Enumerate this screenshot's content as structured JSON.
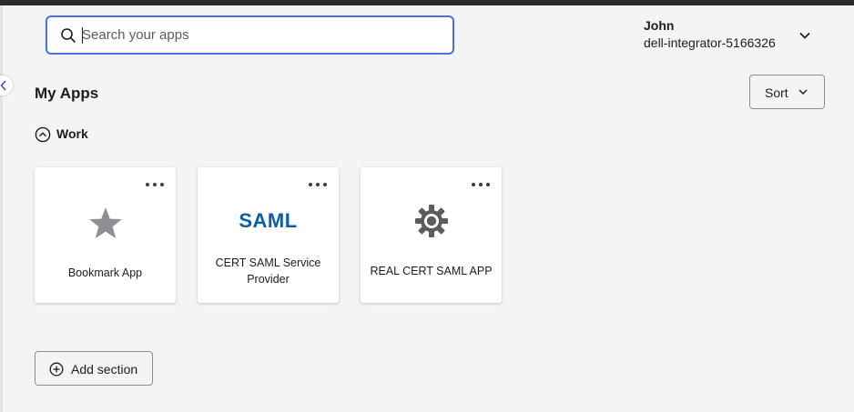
{
  "search": {
    "placeholder": "Search your apps",
    "value": ""
  },
  "user": {
    "name": "John",
    "org": "dell-integrator-5166326"
  },
  "page": {
    "title": "My Apps",
    "sort_label": "Sort"
  },
  "sections": [
    {
      "label": "Work",
      "apps": [
        {
          "label": "Bookmark App",
          "icon": "star-icon"
        },
        {
          "label": "CERT SAML Service Provider",
          "icon": "saml-logo",
          "logo_text": "SAML"
        },
        {
          "label": "REAL CERT SAML APP",
          "icon": "gear-icon"
        }
      ]
    }
  ],
  "add_section_label": "Add section",
  "colors": {
    "focus": "#4b6ee0",
    "saml": "#0b5ea8",
    "background": "#f4f4f4"
  }
}
